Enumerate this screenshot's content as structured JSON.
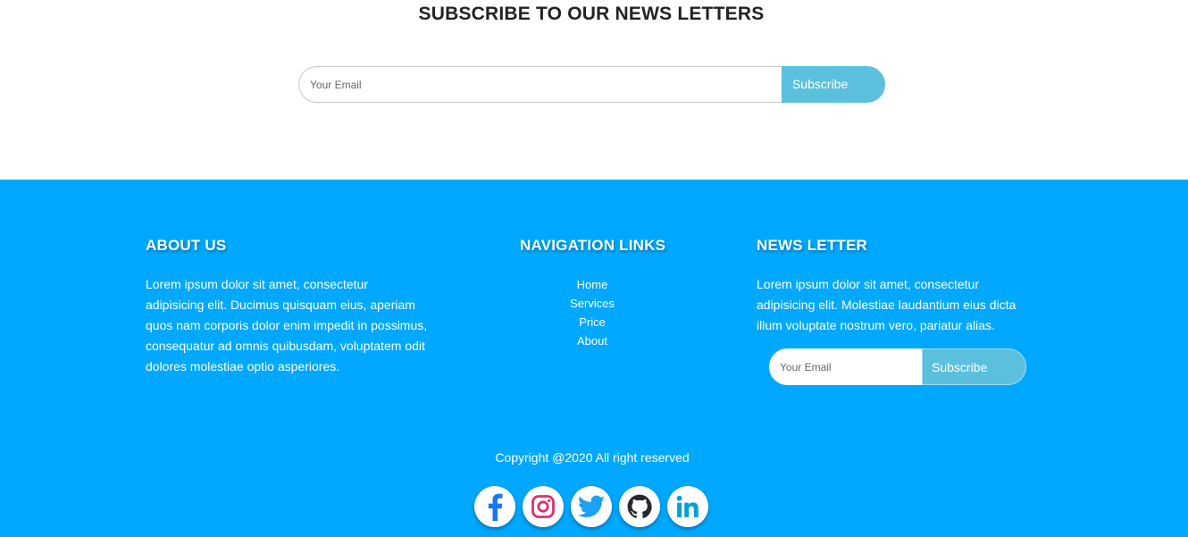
{
  "subscribe": {
    "title": "SUBSCRIBE TO OUR NEWS LETTERS",
    "email_placeholder": "Your Email",
    "button_label": "Subscribe"
  },
  "footer": {
    "about": {
      "title": "ABOUT US",
      "text": "Lorem ipsum dolor sit amet, consectetur adipisicing elit. Ducimus quisquam eius, aperiam quos nam corporis dolor enim impedit in possimus, consequatur ad omnis quibusdam, voluptatem odit dolores molestiae optio asperiores."
    },
    "navigation": {
      "title": "NAVIGATION LINKS",
      "links": [
        "Home",
        "Services",
        "Price",
        "About"
      ]
    },
    "newsletter": {
      "title": "NEWS LETTER",
      "text": "Lorem ipsum dolor sit amet, consectetur adipisicing elit. Molestiae laudantium eius dicta illum voluptate nostrum vero, pariatur alias.",
      "email_placeholder": "Your Email",
      "button_label": "Subscribe"
    },
    "copyright": "Copyright @2020 All right reserved",
    "socials": [
      {
        "name": "facebook-icon",
        "color": "#1877f2"
      },
      {
        "name": "instagram-icon",
        "color": "#e4405f"
      },
      {
        "name": "twitter-icon",
        "color": "#1da1f2"
      },
      {
        "name": "github-icon",
        "color": "#24292e"
      },
      {
        "name": "linkedin-icon",
        "color": "#00a0dc"
      }
    ]
  },
  "colors": {
    "footer_bg": "#00a8ff",
    "button_bg": "#5bc0de"
  }
}
